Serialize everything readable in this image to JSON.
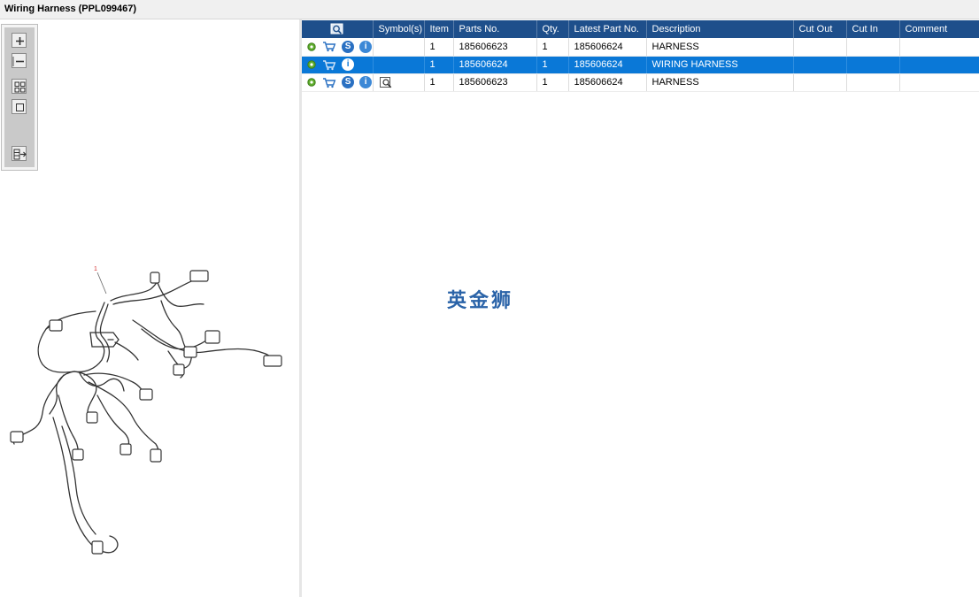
{
  "window": {
    "title": "Wiring Harness (PPL099467)"
  },
  "toolbar": {
    "buttons": [
      "zoom-in-icon",
      "zoom-out-icon",
      "fit-all-icon",
      "fit-window-icon",
      "export-icon"
    ]
  },
  "drawing": {
    "callout": "1"
  },
  "table": {
    "columns": [
      "",
      "Symbol(s)",
      "Item",
      "Parts No.",
      "Qty.",
      "Latest Part No.",
      "Description",
      "Cut Out",
      "Cut In",
      "Comment"
    ],
    "rows": [
      {
        "icons": [
          "gear-icon",
          "cart-icon",
          "s-icon",
          "info-icon"
        ],
        "symbols": "",
        "item": "1",
        "part_no": "185606623",
        "qty": "1",
        "latest_part_no": "185606624",
        "description": "HARNESS",
        "cut_out": "",
        "cut_in": "",
        "comment": "",
        "selected": false
      },
      {
        "icons": [
          "gear-icon",
          "cart-icon",
          "info-icon"
        ],
        "symbols": "",
        "item": "1",
        "part_no": "185606624",
        "qty": "1",
        "latest_part_no": "185606624",
        "description": "WIRING HARNESS",
        "cut_out": "",
        "cut_in": "",
        "comment": "",
        "selected": true
      },
      {
        "icons": [
          "gear-icon",
          "cart-icon",
          "s-icon",
          "info-icon"
        ],
        "symbols": "magnifier-doc-icon",
        "item": "1",
        "part_no": "185606623",
        "qty": "1",
        "latest_part_no": "185606624",
        "description": "HARNESS",
        "cut_out": "",
        "cut_in": "",
        "comment": "",
        "selected": false
      }
    ]
  },
  "watermark": {
    "text": "英金狮"
  },
  "colors": {
    "header": "#1e4f8b",
    "selected_row": "#0a78d7",
    "watermark": "#2a63a8"
  }
}
